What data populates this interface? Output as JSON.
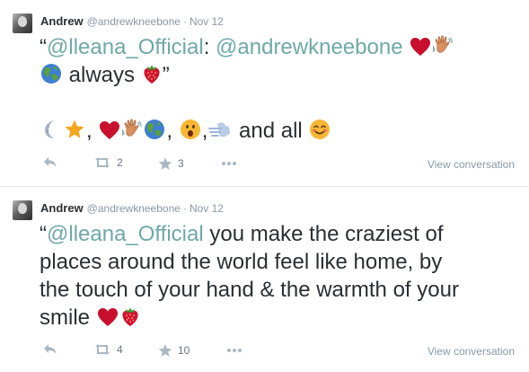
{
  "tweets": [
    {
      "name": "Andrew",
      "handle": "@andrewkneebone",
      "separator": "·",
      "time": "Nov 12",
      "quote_open": "“",
      "mention1": "@lleana_Official",
      "colon": ":",
      "mention2": "@andrewkneebone",
      "line2_text": "always",
      "quote_close": "”",
      "line3_sep1": ",",
      "line3_sep2": ",",
      "line3_sep3": ",",
      "line3_text": "and all",
      "retweet_count": "2",
      "favorite_count": "3",
      "view_conversation": "View conversation"
    },
    {
      "name": "Andrew",
      "handle": "@andrewkneebone",
      "separator": "·",
      "time": "Nov 12",
      "quote_open": "“",
      "mention1": "@lleana_Official",
      "text_line1_rest": "you make the craziest of",
      "text_line2": "places around the world feel like home, by",
      "text_line3": "the touch of your hand & the warmth of your",
      "text_line4": "smile",
      "retweet_count": "4",
      "favorite_count": "10",
      "view_conversation": "View conversation"
    }
  ],
  "icons": {
    "reply": "reply-icon",
    "retweet": "retweet-icon",
    "favorite": "star-icon",
    "more": "more-icon"
  },
  "colors": {
    "text": "#292f33",
    "meta": "#8899a6",
    "mention": "#6fa8a8",
    "border": "#e1e8ed"
  }
}
